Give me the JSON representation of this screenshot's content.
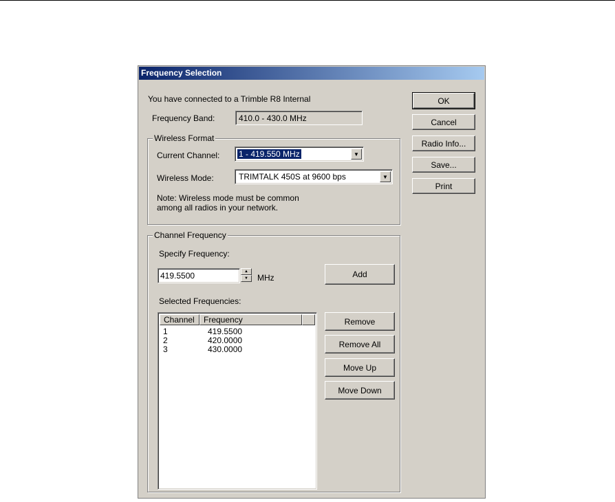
{
  "dialog": {
    "title": "Frequency Selection",
    "connected_text": "You have connected to a Trimble R8 Internal",
    "frequency_band_label": "Frequency Band:",
    "frequency_band_value": "410.0 - 430.0 MHz"
  },
  "wireless_format": {
    "legend": "Wireless Format",
    "current_channel_label": "Current Channel:",
    "current_channel_value": "1 - 419.550 MHz",
    "wireless_mode_label": "Wireless Mode:",
    "wireless_mode_value": "TRIMTALK 450S at 9600 bps",
    "note_line1": "Note: Wireless mode must be common",
    "note_line2": "among all radios in your network."
  },
  "channel_frequency": {
    "legend": "Channel Frequency",
    "specify_label": "Specify Frequency:",
    "frequency_input_value": "419.5500",
    "unit": "MHz",
    "add_label": "Add",
    "selected_label": "Selected Frequencies:",
    "columns": [
      "Channel",
      "Frequency"
    ],
    "rows": [
      {
        "channel": "1",
        "frequency": "419.5500"
      },
      {
        "channel": "2",
        "frequency": "420.0000"
      },
      {
        "channel": "3",
        "frequency": "430.0000"
      }
    ],
    "remove_label": "Remove",
    "remove_all_label": "Remove All",
    "move_up_label": "Move Up",
    "move_down_label": "Move Down"
  },
  "side_buttons": {
    "ok": "OK",
    "cancel": "Cancel",
    "radio_info": "Radio Info...",
    "save": "Save...",
    "print": "Print"
  },
  "icons": {
    "combo_arrow": "chevron-down-icon",
    "spin_up": "arrow-up-icon",
    "spin_down": "arrow-down-icon"
  }
}
